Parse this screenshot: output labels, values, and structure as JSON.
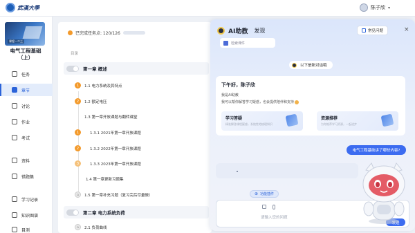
{
  "header": {
    "logo_text": "武漢大學",
    "user_name": "陈子欣"
  },
  "sidebar": {
    "course_tag": "课程一二三",
    "course_title": "电气工程基础（上）",
    "items": [
      {
        "label": "任务",
        "icon": "task-icon",
        "active": false
      },
      {
        "label": "章节",
        "icon": "chapter-icon",
        "active": true
      },
      {
        "label": "讨论",
        "icon": "discussion-icon",
        "active": false
      },
      {
        "label": "作业",
        "icon": "homework-icon",
        "active": false
      },
      {
        "label": "考试",
        "icon": "exam-icon",
        "active": false
      },
      {
        "label": "资料",
        "icon": "materials-icon",
        "active": false
      },
      {
        "label": "错题集",
        "icon": "mistakes-icon",
        "active": false
      },
      {
        "label": "学习记录",
        "icon": "record-icon",
        "active": false
      },
      {
        "label": "知识图谱",
        "icon": "knowledge-graph-icon",
        "active": false
      },
      {
        "label": "目测",
        "icon": "assessment-icon",
        "active": false
      }
    ]
  },
  "main": {
    "progress_text": "已完成任务点: 120/126",
    "toc_label": "目录",
    "chapter1": "第一章 概述",
    "chapter2": "第二章 电力系统负荷",
    "sections": [
      {
        "num": "1",
        "title": "1.1 电力系统及其特点",
        "indent": 0
      },
      {
        "num": "2",
        "title": "1.2 额定电压",
        "indent": 0
      },
      {
        "num": "",
        "title": "1.3 第一章开放课题与翻转课堂",
        "indent": 0
      },
      {
        "num": "1",
        "title": "1.3.1 2021年第一章开放课题",
        "indent": 1
      },
      {
        "num": "2",
        "title": "1.3.2 2022年第一章开放课题",
        "indent": 1
      },
      {
        "num": "3",
        "title": "1.3.3 2023年第一章开放课题",
        "indent": 1
      },
      {
        "num": "",
        "title": "1.4 第一章更新习题集",
        "indent": 0
      },
      {
        "num": "",
        "title": "1.5 第一章补充习题（复习完后尽量做）",
        "indent": 0
      },
      {
        "num": "",
        "title": "2.1 负荷曲线",
        "indent": 0
      }
    ]
  },
  "ai_panel": {
    "title": "AI助教",
    "tab_discover": "发现",
    "faq_label": "常见问题",
    "close_glyph": "×",
    "cut_card_text": "检索课件",
    "new_chat_label": "以下是新对话哦",
    "greeting_title": "下午好，陈子欣",
    "intro_line1": "我是AI助教",
    "intro_line2": "我可以帮你解答学习疑惑，也会提供陪伴和支持",
    "feature1_title": "学习答疑",
    "feature1_sub": "精准解答课程疑惑，系统性地梳理知识",
    "feature2_title": "资源推荐",
    "feature2_sub": "为你推荐学习资源，一起进步",
    "user_question": "电气工程基础讲了哪些内容?",
    "plugin_label": "功能插件",
    "input_placeholder": "请输入您的问题",
    "send_label": "发送"
  },
  "colors": {
    "accent": "#3c6cf0",
    "progress_orange": "#f39a2b",
    "sidebar_active": "#2b63d9"
  }
}
